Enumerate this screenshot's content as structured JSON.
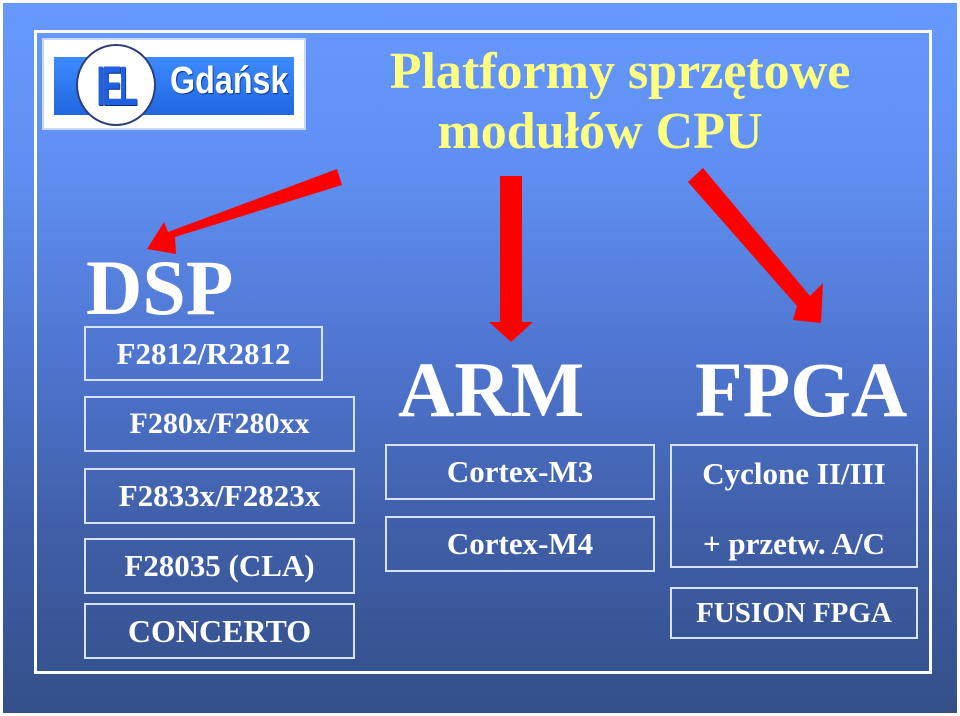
{
  "logo": {
    "mark": "IEL",
    "city": "Gdańsk"
  },
  "title": {
    "line1": "Platformy sprzętowe",
    "line2": "modułów CPU"
  },
  "colors": {
    "title": "#ffff80",
    "arrow": "#ff0000",
    "background_top": "#6699ff",
    "background_bottom": "#33508a",
    "text": "#ffffff"
  },
  "columns": {
    "dsp": {
      "heading": "DSP",
      "items": [
        "F2812/R2812",
        "F280x/F280xx",
        "F2833x/F2823x",
        "F28035 (CLA)",
        "CONCERTO"
      ]
    },
    "arm": {
      "heading": "ARM",
      "items": [
        "Cortex-M3",
        "Cortex-M4"
      ]
    },
    "fpga": {
      "heading": "FPGA",
      "items": [
        "Cyclone II/III",
        "+ przetw. A/C",
        "FUSION FPGA"
      ]
    }
  }
}
